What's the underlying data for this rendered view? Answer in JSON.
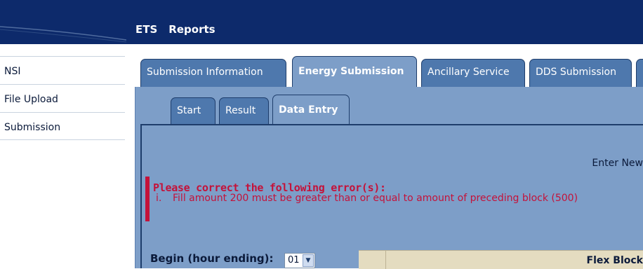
{
  "topmenu": [
    "ETS",
    "Reports"
  ],
  "leftnav": [
    "NSI",
    "File Upload",
    "Submission"
  ],
  "tabs": {
    "submission_information": "Submission Information",
    "energy_submission": "Energy Submission",
    "ancillary_service": "Ancillary Service",
    "dds_submission": "DDS Submission"
  },
  "subtabs": {
    "start": "Start",
    "result": "Result",
    "data_entry": "Data Entry"
  },
  "enter_new": "Enter New",
  "error": {
    "title": "Please correct the following error(s):",
    "items": [
      {
        "num": "i.",
        "text": "Fill amount 200 must be greater than or equal to amount of preceding block (500)"
      }
    ]
  },
  "begin": {
    "label": "Begin (hour ending):",
    "value": "01"
  },
  "grid": {
    "header": "Flex Block"
  }
}
